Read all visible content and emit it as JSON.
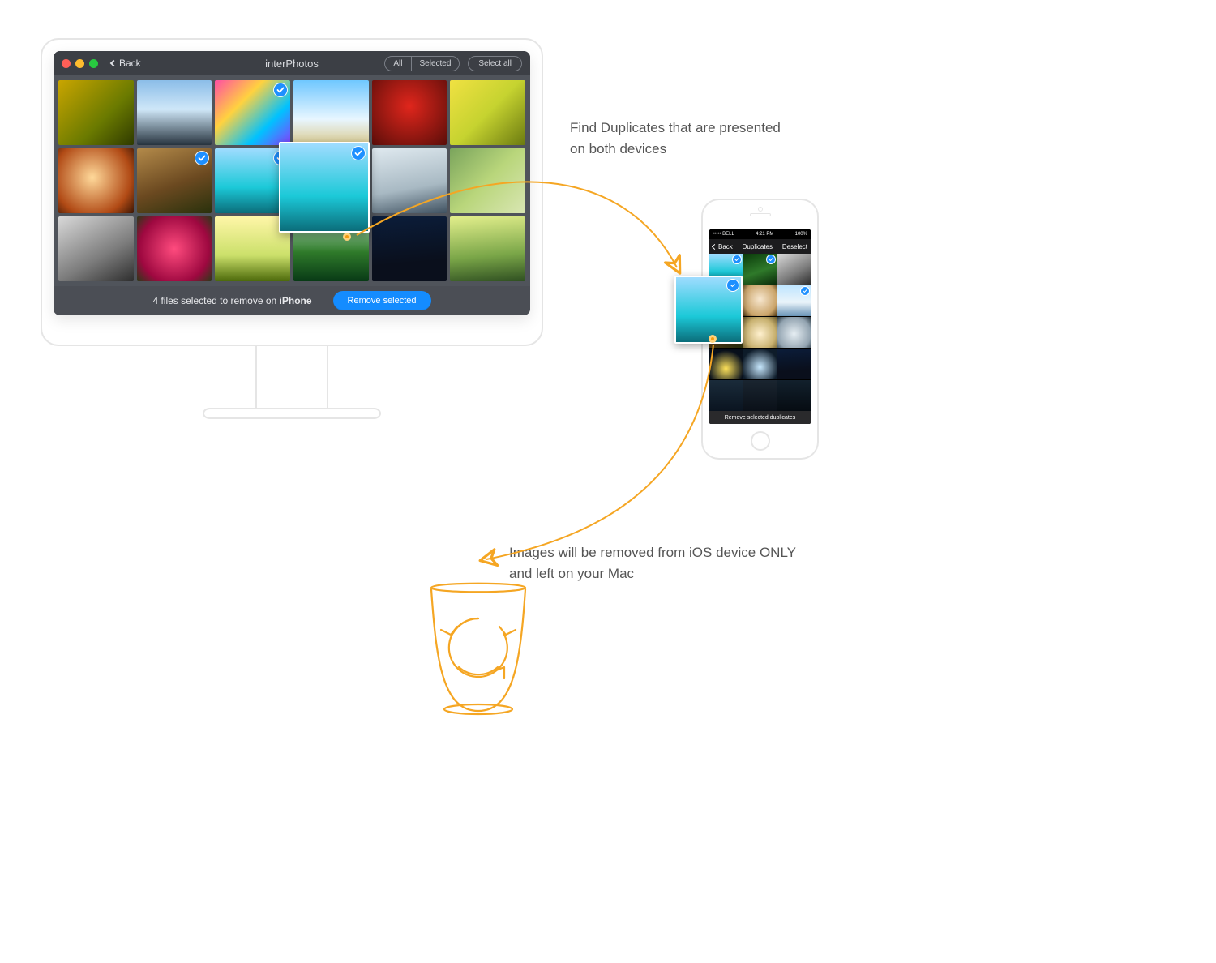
{
  "mac": {
    "app_title": "interPhotos",
    "back_label": "Back",
    "filter_all": "All",
    "filter_selected": "Selected",
    "select_all": "Select all",
    "status_prefix": "4 files selected to remove on ",
    "status_device": "iPhone",
    "remove_button": "Remove selected",
    "thumbs": [
      {
        "bg": "linear-gradient(135deg,#c9a500,#6a7a00 60%,#2f3a00)",
        "selected": false
      },
      {
        "bg": "linear-gradient(180deg,#8bbde8,#cfe7f8 45%,#27343f)",
        "selected": false
      },
      {
        "bg": "linear-gradient(135deg,#ff4fa3,#ffd23f 35%,#00c2ff 70%,#8a3cff)",
        "selected": true
      },
      {
        "bg": "linear-gradient(180deg,#6fc7ff,#e8f6ff 60%,#d9c98d)",
        "selected": false
      },
      {
        "bg": "radial-gradient(circle at 50% 40%,#e0261c,#5a0d09)",
        "selected": false
      },
      {
        "bg": "linear-gradient(135deg,#f0e142,#c6d330 50%,#6b7a10)",
        "selected": false
      },
      {
        "bg": "radial-gradient(circle at 45% 45%,#ffd99a,#b14a15 70%,#3b1604)",
        "selected": false
      },
      {
        "bg": "linear-gradient(160deg,#b38a4a,#6b4920 55%,#29310c)",
        "selected": true
      },
      {
        "bg": "linear-gradient(180deg,#9fdcff,#1cc9d8 60%,#0b6d7a)",
        "selected": true
      },
      {
        "bg": "linear-gradient(180deg,#bfe5ff,#eaf4fa 55%,#6893b6)",
        "selected": true
      },
      {
        "bg": "linear-gradient(170deg,#dfe9ef,#a8b9c3 60%,#3f5160)",
        "selected": false
      },
      {
        "bg": "linear-gradient(135deg,#7aa45c,#b9d67b 50%,#d9e6b3)",
        "selected": false
      },
      {
        "bg": "linear-gradient(150deg,#d9d9d9,#7c7c7c 60%,#2e2e2e)",
        "selected": false
      },
      {
        "bg": "radial-gradient(circle at 50% 50%,#ff4b7e,#9e0840 70%,#2b3a17)",
        "selected": false
      },
      {
        "bg": "linear-gradient(180deg,#fff6a8,#cbe06a 60%,#4d6a0b)",
        "selected": false
      },
      {
        "bg": "linear-gradient(180deg,#b8e6c1,#2f7a2a 55%,#083a16)",
        "selected": false
      },
      {
        "bg": "linear-gradient(175deg,#0b1d3a,#0a0f1c 70%)",
        "selected": false
      },
      {
        "bg": "linear-gradient(175deg,#e3ef8c,#7aa648 60%,#2f4f21)",
        "selected": false
      }
    ],
    "popped_bg": "linear-gradient(180deg,#9fdcff,#1cc9d8 60%,#0b6d7a)"
  },
  "phone": {
    "status_carrier": "••••• BELL",
    "status_time": "4:21 PM",
    "status_batt": "100%",
    "nav_back": "Back",
    "nav_title": "Duplicates",
    "nav_action": "Deselect",
    "footer": "Remove selected duplicates",
    "thumbs": [
      {
        "bg": "linear-gradient(180deg,#9fdcff,#1cc9d8 60%,#0b6d7a)",
        "selected": true
      },
      {
        "bg": "linear-gradient(160deg,#0a3a0a,#2f7a2a 55%,#0a2a0a)",
        "selected": true
      },
      {
        "bg": "linear-gradient(150deg,#d9d9d9,#7c7c7c 60%,#2e2e2e)",
        "selected": false
      },
      {
        "bg": "linear-gradient(135deg,#ff4fa3,#ffd23f 35%,#00c2ff 70%,#8a3cff)",
        "selected": true
      },
      {
        "bg": "radial-gradient(circle at 50% 45%,#f7e7cf,#caa46a 70%,#4e3510)",
        "selected": false
      },
      {
        "bg": "linear-gradient(180deg,#bfe5ff,#eaf4fa 55%,#6893b6)",
        "selected": true
      },
      {
        "bg": "linear-gradient(160deg,#b38a4a,#6b4920 55%,#29310c)",
        "selected": false
      },
      {
        "bg": "radial-gradient(circle at 50% 55%,#fff1cf,#c8b170 65%,#6b5b2c)",
        "selected": false
      },
      {
        "bg": "radial-gradient(circle at 50% 55%,#e6eef3,#92a3b0 70%,#2b3a44)",
        "selected": false
      },
      {
        "bg": "radial-gradient(circle at 50% 65%,#ffe35a,#08101c 70%)",
        "selected": false
      },
      {
        "bg": "radial-gradient(circle at 50% 60%,#c8e9ff,#0e1c2a 75%)",
        "selected": false
      },
      {
        "bg": "linear-gradient(175deg,#0b1d3a,#0a0f1c 70%)",
        "selected": false
      },
      {
        "bg": "linear-gradient(180deg,#1a2b3a,#0a1420)",
        "selected": false
      },
      {
        "bg": "linear-gradient(180deg,#1a2530,#0a1018)",
        "selected": false
      },
      {
        "bg": "linear-gradient(180deg,#12202c,#060c12)",
        "selected": false
      }
    ],
    "popped_bg": "linear-gradient(180deg,#9fdcff,#1cc9d8 60%,#0b6d7a)"
  },
  "annotations": {
    "a1_line1": "Find Duplicates that are presented",
    "a1_line2": "on both devices",
    "a2_line1": "Images will be removed from iOS device ONLY",
    "a2_line2": "and left on your Mac"
  },
  "colors": {
    "arrow": "#f5a623"
  }
}
